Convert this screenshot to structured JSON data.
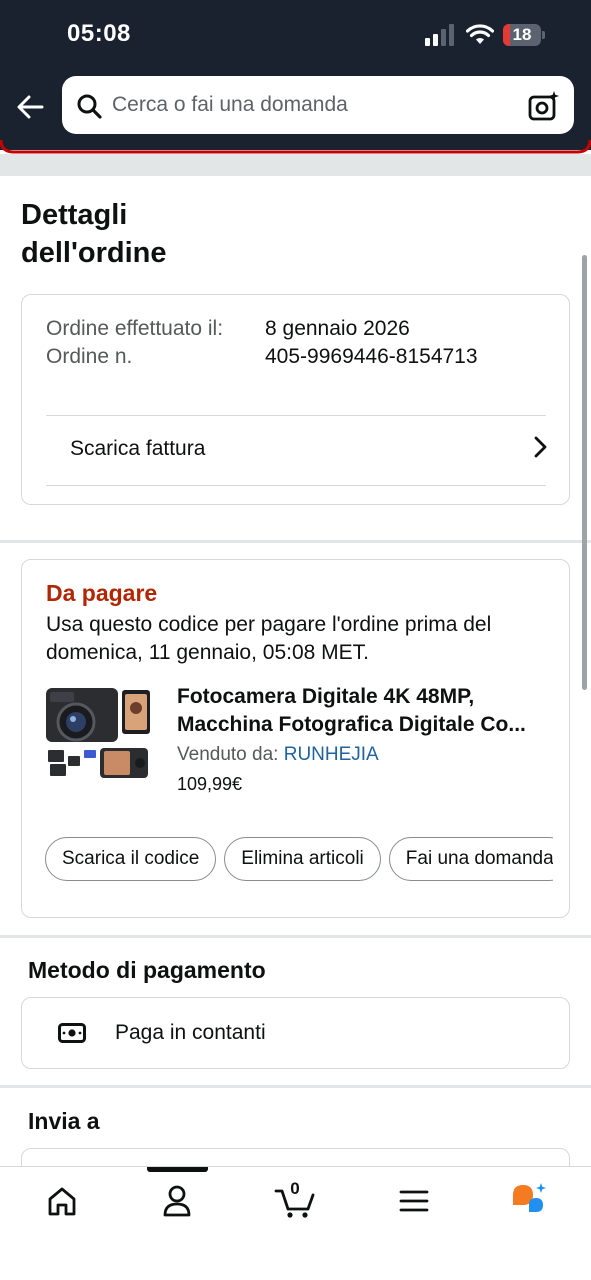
{
  "status_bar": {
    "time": "05:08",
    "battery": "18"
  },
  "search": {
    "placeholder": "Cerca o fai una domanda"
  },
  "page": {
    "title": "Dettagli dell'ordine"
  },
  "order": {
    "placed_label": "Ordine effettuato il:",
    "number_label": "Ordine n.",
    "date": "8 gennaio 2026",
    "number": "405-9969446-8154713",
    "invoice_label": "Scarica fattura"
  },
  "payment_due": {
    "title": "Da pagare",
    "description": "Usa questo codice per pagare l'ordine prima del domenica, 11 gennaio, 05:08 MET.",
    "product": {
      "title_line1": "Fotocamera Digitale 4K 48MP,",
      "title_line2": "Macchina Fotografica Digitale Co...",
      "sold_by_label": "Venduto da:",
      "seller": "RUNHEJIA",
      "price": "109,99€"
    },
    "actions": [
      "Scarica il codice",
      "Elimina articoli",
      "Fai una domanda"
    ]
  },
  "payment_method": {
    "heading": "Metodo di pagamento",
    "method": "Paga in contanti"
  },
  "shipping": {
    "heading": "Invia a"
  },
  "bottom_nav": {
    "cart_count": "0"
  },
  "colors": {
    "header_bg": "#1a2230",
    "accent_red": "#b12704",
    "link_blue": "#2162a1",
    "battery_red": "#e53935",
    "assistant_orange": "#f47b20",
    "assistant_blue": "#1f8ff0"
  },
  "icons": [
    "back-arrow-icon",
    "search-icon",
    "camera-search-icon",
    "chevron-right-icon",
    "cash-icon",
    "home-icon",
    "account-icon",
    "cart-icon",
    "menu-icon",
    "assistant-icon"
  ]
}
